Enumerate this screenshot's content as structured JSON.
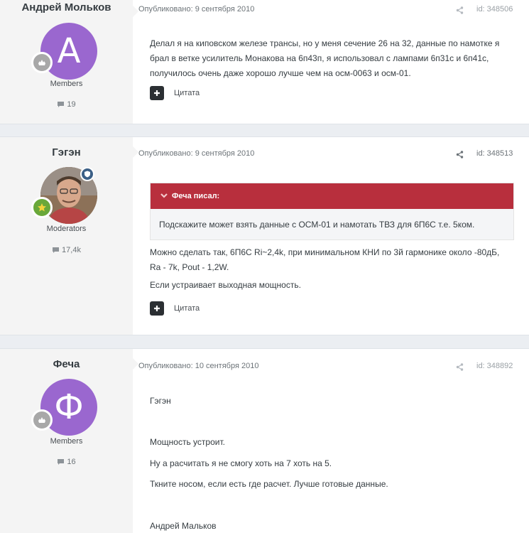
{
  "posts": [
    {
      "author": "Андрей Мольков",
      "avatar_letter": "А",
      "group": "Members",
      "post_count": "19",
      "published": "Опубликовано: 9 сентября 2010",
      "id_label": "id: 348506",
      "body": [
        "Делал я на киповском железе трансы, но у меня сечение 26 на 32, данные по намотке я брал в ветке усилитель Монакова на 6п43п, я использовал с лампами 6п31с и 6п41с, получилось очень даже хорошо лучше чем на осм-0063 и осм-01."
      ],
      "quote_button": "Цитата"
    },
    {
      "author": "Гэгэн",
      "group": "Moderators",
      "post_count": "17,4k",
      "published": "Опубликовано: 9 сентября 2010",
      "id_label": "id: 348513",
      "quote_author": "Феча писал:",
      "quote_text": "Подскажите может взять данные с ОСМ-01 и намотать ТВЗ для 6П6С т.е. 5ком.",
      "body": [
        "Можно сделать так, 6П6С Ri~2,4k, при минимальном КНИ по 3й гармонике около -80дБ, Ra - 7k, Pout - 1,2W.",
        "Если устраивает выходная мощность."
      ],
      "quote_button": "Цитата"
    },
    {
      "author": "Феча",
      "avatar_letter": "Ф",
      "group": "Members",
      "post_count": "16",
      "published": "Опубликовано: 10 сентября 2010",
      "id_label": "id: 348892",
      "body": [
        "Гэгэн",
        "Мощность устроит.",
        "Ну а расчитать я не смогу хоть на 7 хоть на 5.",
        "Ткните носом, если есть где расчет. Лучше готовые данные.",
        "Андрей Мальков"
      ]
    }
  ],
  "colors": {
    "accent_purple": "#9a67cf",
    "quote_header": "#b82f3d",
    "author_panel": "#f4f4f4",
    "page_bg": "#ebeef2"
  },
  "icons": [
    "comment-icon",
    "share-icon",
    "plus-icon",
    "chevron-down-icon",
    "shield-icon",
    "rank-badge-icon"
  ]
}
